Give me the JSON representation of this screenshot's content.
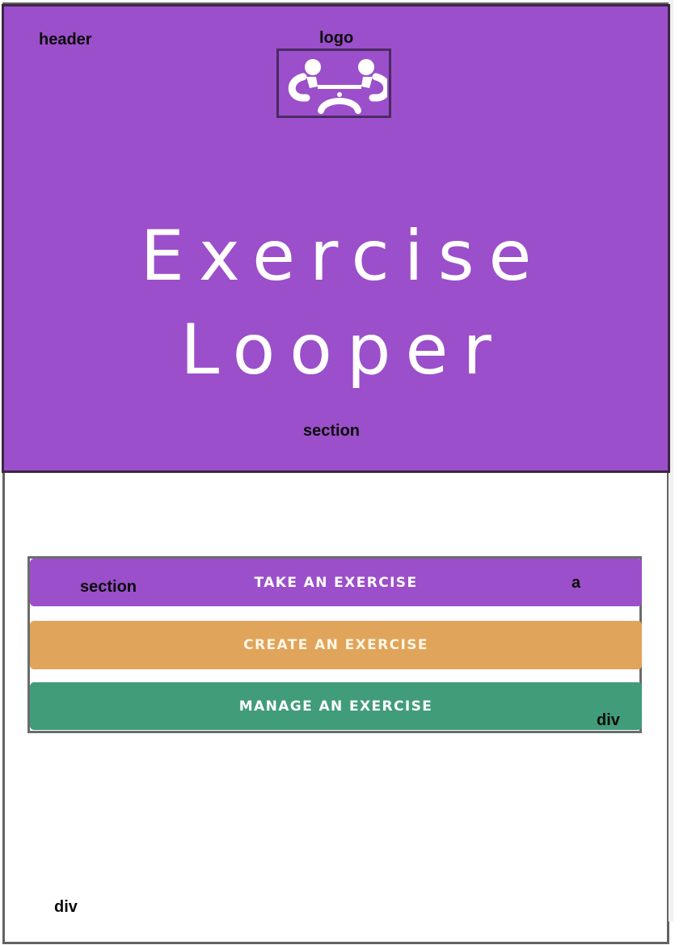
{
  "annotations": {
    "header": "header",
    "logo": "logo",
    "hero_section": "section",
    "button_section": "section",
    "link": "a",
    "button_div": "div",
    "outer_div": "div"
  },
  "hero": {
    "title_line1": "Exercise",
    "title_line2": "Looper"
  },
  "buttons": {
    "take": "TAKE AN EXERCISE",
    "create": "CREATE AN EXERCISE",
    "manage": "MANAGE AN EXERCISE"
  },
  "icons": {
    "logo": "people-at-table-icon"
  },
  "colors": {
    "purple": "#9b4fca",
    "orange": "#e0a45a",
    "green": "#419c79"
  }
}
